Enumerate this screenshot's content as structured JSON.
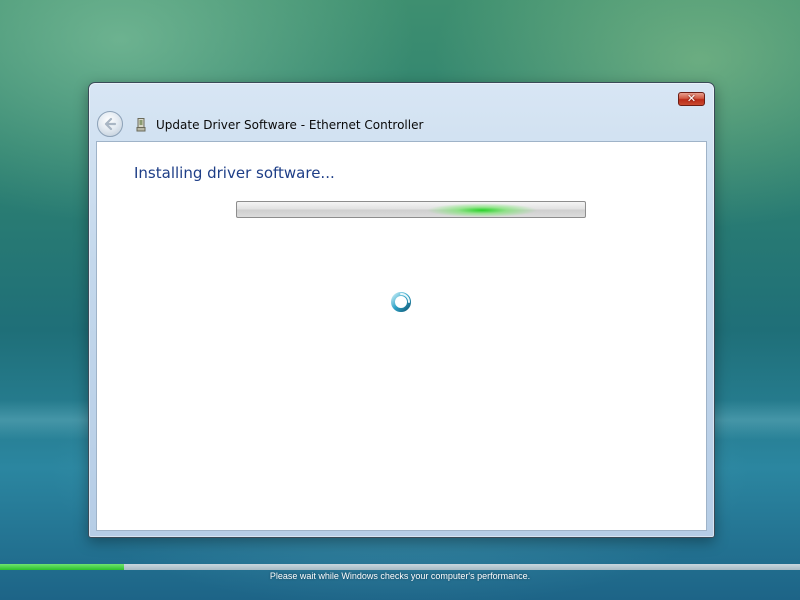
{
  "window": {
    "title": "Update Driver Software - Ethernet Controller",
    "close_label": "✕"
  },
  "icons": {
    "back": "back-arrow-icon",
    "device": "network-adapter-icon",
    "spinner": "busy-spinner-icon"
  },
  "content": {
    "heading": "Installing driver software...",
    "progress": {
      "mode": "indeterminate"
    }
  },
  "status": {
    "progress_percent": 15.5,
    "text": "Please wait while Windows checks your computer's performance."
  },
  "colors": {
    "heading": "#1e3e87",
    "progress_glow": "#28d228",
    "status_fill": "#2cc12c",
    "close_button": "#c94a2f"
  }
}
